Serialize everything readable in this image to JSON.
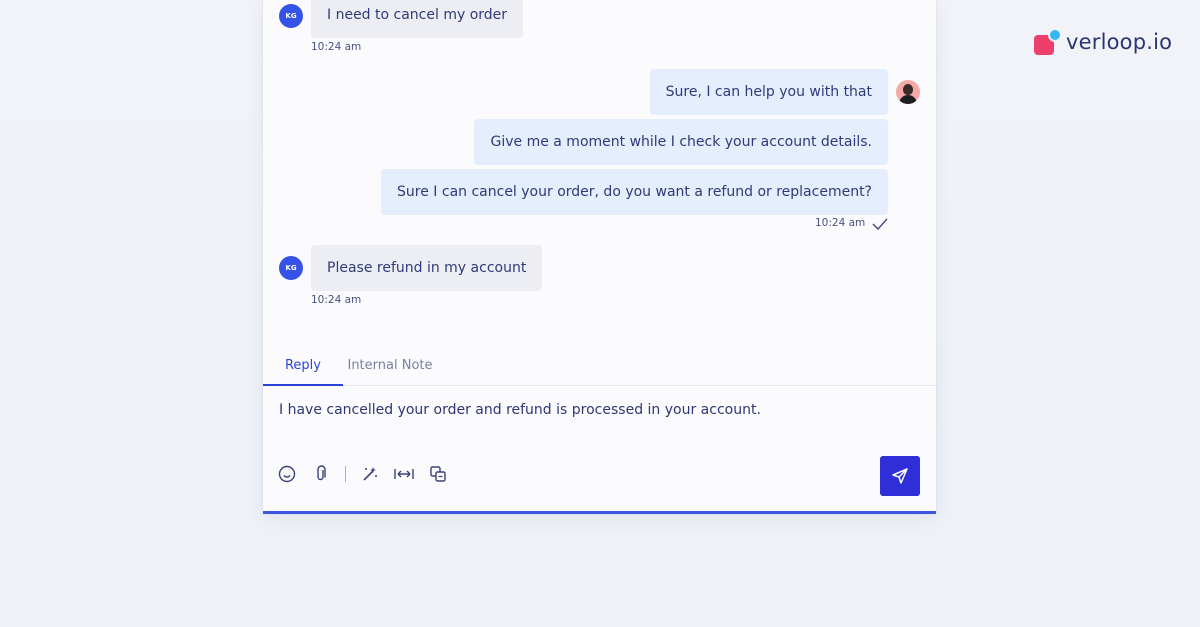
{
  "brand": {
    "name": "verloop.io"
  },
  "messages": [
    {
      "sender": "customer",
      "avatar": "KG",
      "text": "I need to cancel my order",
      "time": "10:24 am"
    },
    {
      "sender": "agent",
      "text": "Sure, I can help you with that"
    },
    {
      "sender": "agent",
      "text": "Give me a moment while I check your account details."
    },
    {
      "sender": "agent",
      "text": "Sure I can cancel your order, do you want a refund or replacement?",
      "time": "10:24 am",
      "status": "check-icon"
    },
    {
      "sender": "customer",
      "avatar": "KG",
      "text": "Please refund in my account",
      "time": "10:24 am"
    }
  ],
  "tabs": {
    "reply": "Reply",
    "internal_note": "Internal Note",
    "active": "reply"
  },
  "composer": {
    "value": "I have cancelled your order and refund is processed in your account."
  },
  "toolbar": {
    "icons": [
      "emoji-icon",
      "attachment-icon",
      "magic-wand-icon",
      "expand-width-icon",
      "translate-icon"
    ]
  },
  "colors": {
    "accent": "#2a45d6",
    "send_button": "#2e2fd9",
    "customer_bubble": "#eceef3",
    "agent_bubble": "#e4eefc",
    "avatar": "#3553e6"
  }
}
